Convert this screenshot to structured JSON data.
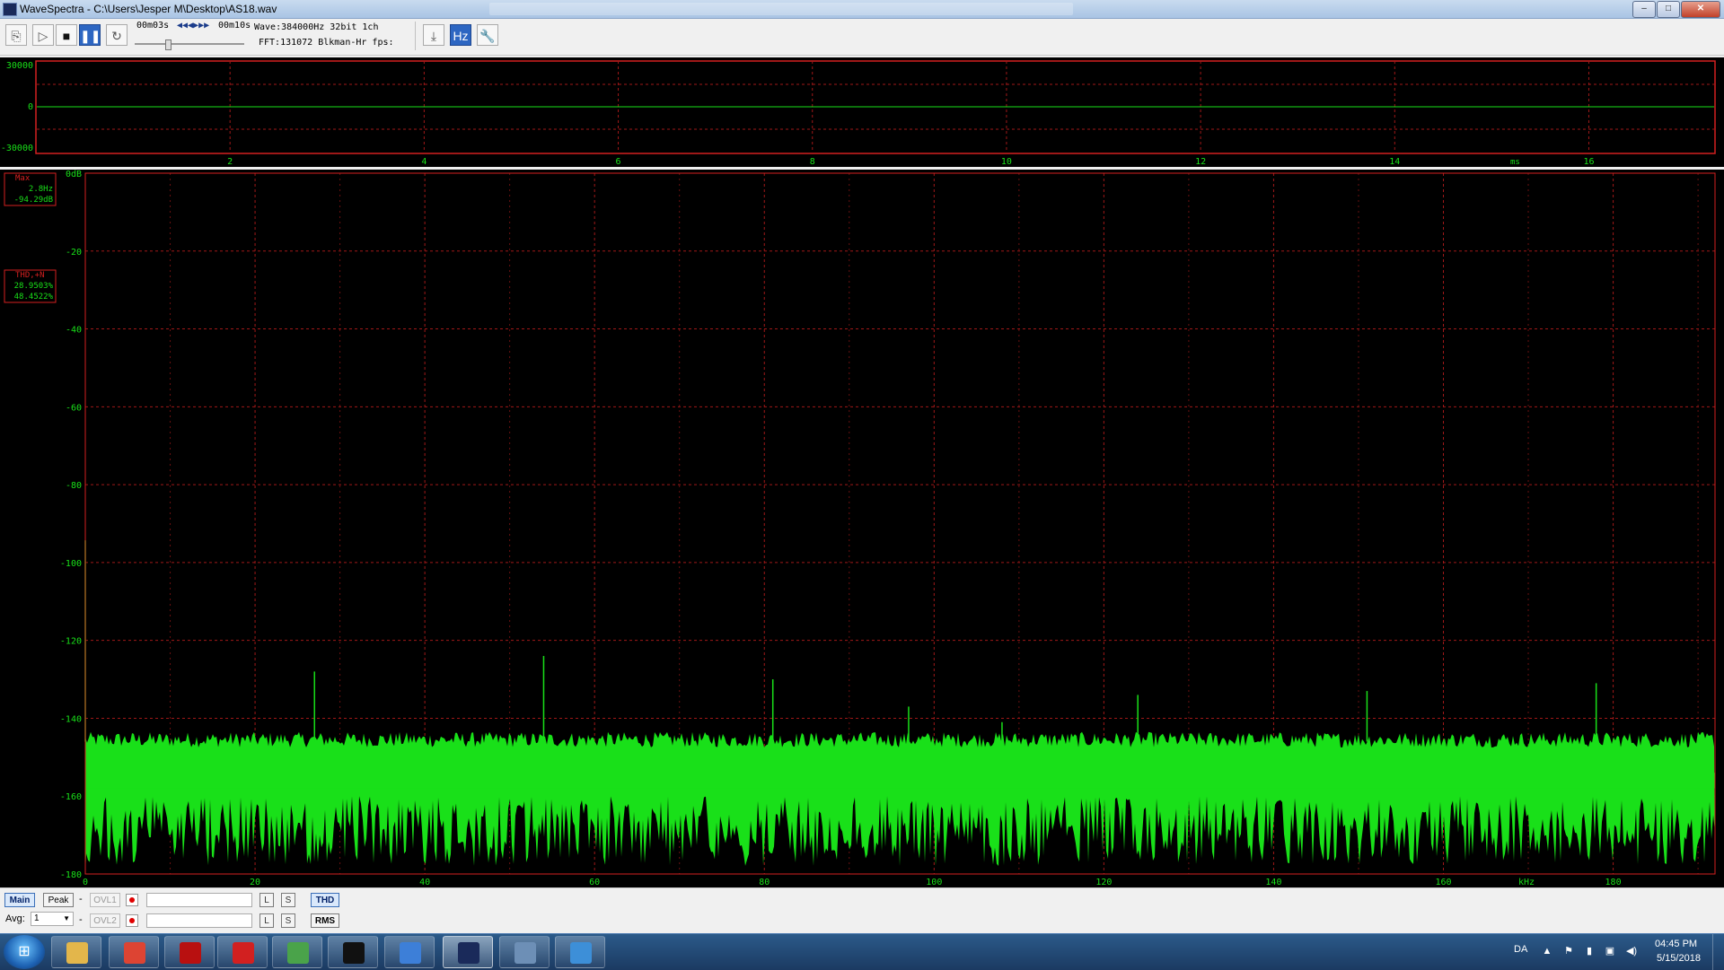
{
  "window": {
    "title": "WaveSpectra - C:\\Users\\Jesper M\\Desktop\\AS18.wav",
    "controls": {
      "minimize": "–",
      "maximize": "□",
      "close": "✕"
    }
  },
  "toolbar": {
    "time_start": "00m03s",
    "time_end": "00m10s",
    "wave_info": "Wave:384000Hz 32bit 1ch",
    "fft_info": "FFT:131072 Blkman-Hr fps:",
    "playback_position": 0.3,
    "icons": [
      "open-icon",
      "play-icon",
      "stop-icon",
      "pause-icon",
      "loop-icon",
      "export-icon",
      "spectrum-settings-icon",
      "tools-icon"
    ]
  },
  "waveform": {
    "y_ticks": [
      "30000",
      "0",
      "-30000"
    ],
    "x_ticks": [
      "2",
      "4",
      "6",
      "8",
      "10",
      "12",
      "14",
      "16"
    ],
    "x_unit": "ms"
  },
  "spectrum": {
    "y_ticks": [
      "0dB",
      "-20",
      "-40",
      "-60",
      "-80",
      "-100",
      "-120",
      "-140",
      "-160",
      "-180"
    ],
    "x_ticks": [
      "0",
      "20",
      "40",
      "60",
      "80",
      "100",
      "120",
      "140",
      "160",
      "180"
    ],
    "x_unit": "kHz",
    "max_box": {
      "label": "Max",
      "freq": "2.8Hz",
      "level": "-94.29dB"
    },
    "thd_box": {
      "label": "THD,+N",
      "thd": "28.9503%",
      "thdn": "48.4522%"
    },
    "chart_data": {
      "type": "line",
      "xlabel": "kHz",
      "ylabel": "dB",
      "xlim": [
        0,
        192
      ],
      "ylim": [
        -180,
        0
      ],
      "x_ticks": [
        0,
        20,
        40,
        60,
        80,
        100,
        120,
        140,
        160,
        180
      ],
      "y_ticks": [
        0,
        -20,
        -40,
        -60,
        -80,
        -100,
        -120,
        -140,
        -160,
        -180
      ],
      "grid": true,
      "noise_floor": {
        "top_db": -146,
        "bottom_db": -180
      },
      "peaks": [
        {
          "x": 0,
          "y": -94.3
        },
        {
          "x": 27,
          "y": -128
        },
        {
          "x": 54,
          "y": -124
        },
        {
          "x": 81,
          "y": -130
        },
        {
          "x": 97,
          "y": -137
        },
        {
          "x": 108,
          "y": -141
        },
        {
          "x": 124,
          "y": -134
        },
        {
          "x": 151,
          "y": -133
        },
        {
          "x": 178,
          "y": -131
        }
      ]
    }
  },
  "bottom": {
    "main_label": "Main",
    "peak_label": "Peak",
    "ovl1_label": "OVL1",
    "ovl2_label": "OVL2",
    "dash": "-",
    "l_label": "L",
    "s_label": "S",
    "thd_label": "THD",
    "rms_label": "RMS",
    "avg_label": "Avg:",
    "avg_value": "1"
  },
  "taskbar": {
    "apps": [
      {
        "name": "explorer",
        "color": "#e3b64b"
      },
      {
        "name": "chrome",
        "color": "#dd4433"
      },
      {
        "name": "acrobat",
        "color": "#b81010"
      },
      {
        "name": "ccleaner",
        "color": "#d22020"
      },
      {
        "name": "paint",
        "color": "#4aa34a"
      },
      {
        "name": "cmd",
        "color": "#111111"
      },
      {
        "name": "wordpad",
        "color": "#3d7fd8"
      },
      {
        "name": "wavespectra",
        "color": "#1a2a5a"
      },
      {
        "name": "window",
        "color": "#6d8fb6"
      },
      {
        "name": "control-panel",
        "color": "#3d8fd8"
      }
    ],
    "language": "DA",
    "time": "04:45 PM",
    "date": "5/15/2018"
  }
}
